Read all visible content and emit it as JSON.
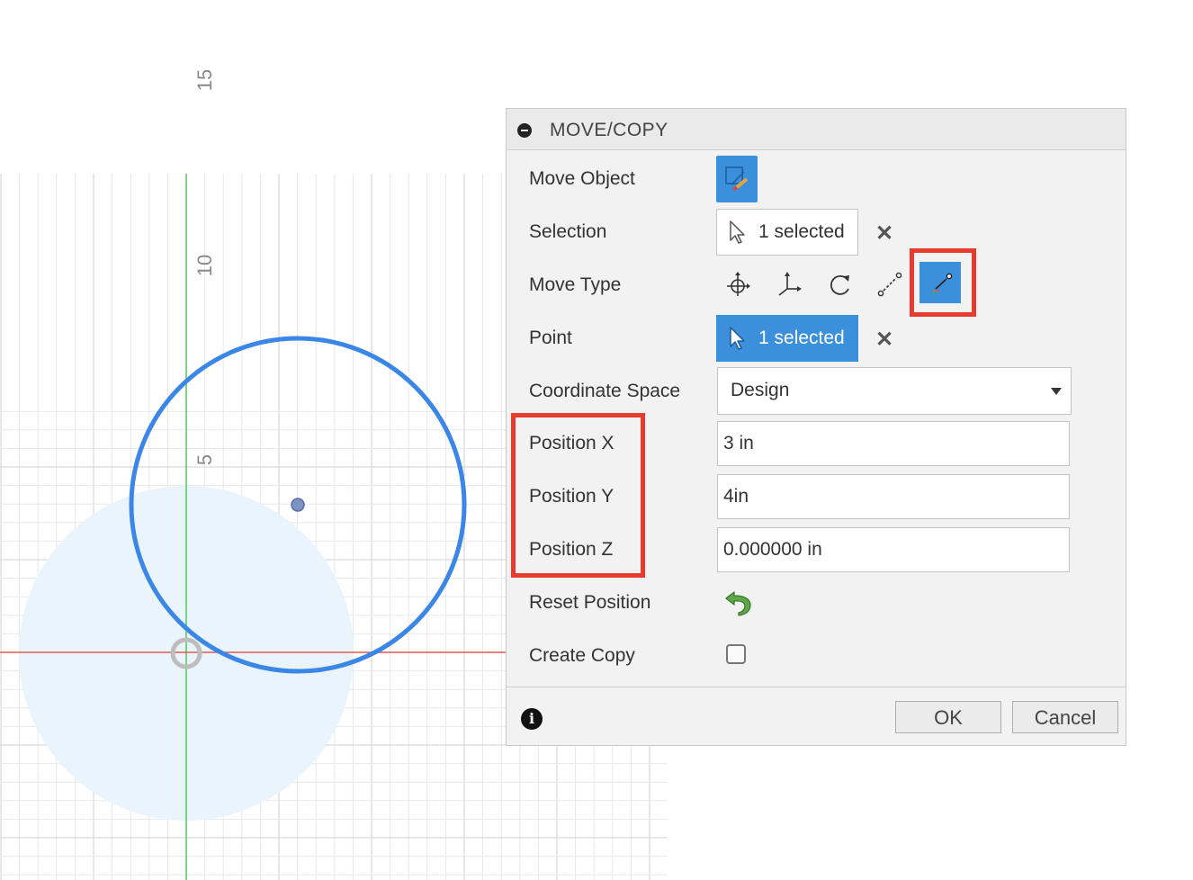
{
  "canvas": {
    "axis_labels": [
      "15",
      "10",
      "5"
    ],
    "colors": {
      "grid": "#e3e3e3",
      "y_axis": "#58c458",
      "x_axis": "#e05a50",
      "circle": "#3b87e8",
      "disc": "#eaf4fc"
    }
  },
  "dialog": {
    "title": "MOVE/COPY",
    "rows": {
      "move_object": "Move Object",
      "selection": "Selection",
      "move_type": "Move Type",
      "point": "Point",
      "coordinate_space": "Coordinate Space",
      "position_x": "Position X",
      "position_y": "Position Y",
      "position_z": "Position Z",
      "reset_position": "Reset Position",
      "create_copy": "Create Copy"
    },
    "selection_value": "1 selected",
    "point_value": "1 selected",
    "coordinate_space_value": "Design",
    "position_x_value": "3 in",
    "position_y_value": "4in",
    "position_z_value": "0.000000 in",
    "create_copy_checked": false,
    "move_type_icons": [
      "free-move-icon",
      "translate-icon",
      "rotate-icon",
      "point-to-point-icon",
      "point-to-position-icon"
    ],
    "active_move_type": "point-to-position-icon",
    "ok_label": "OK",
    "cancel_label": "Cancel",
    "accent": "#3c8fdb",
    "highlight": "#e63b2e"
  }
}
